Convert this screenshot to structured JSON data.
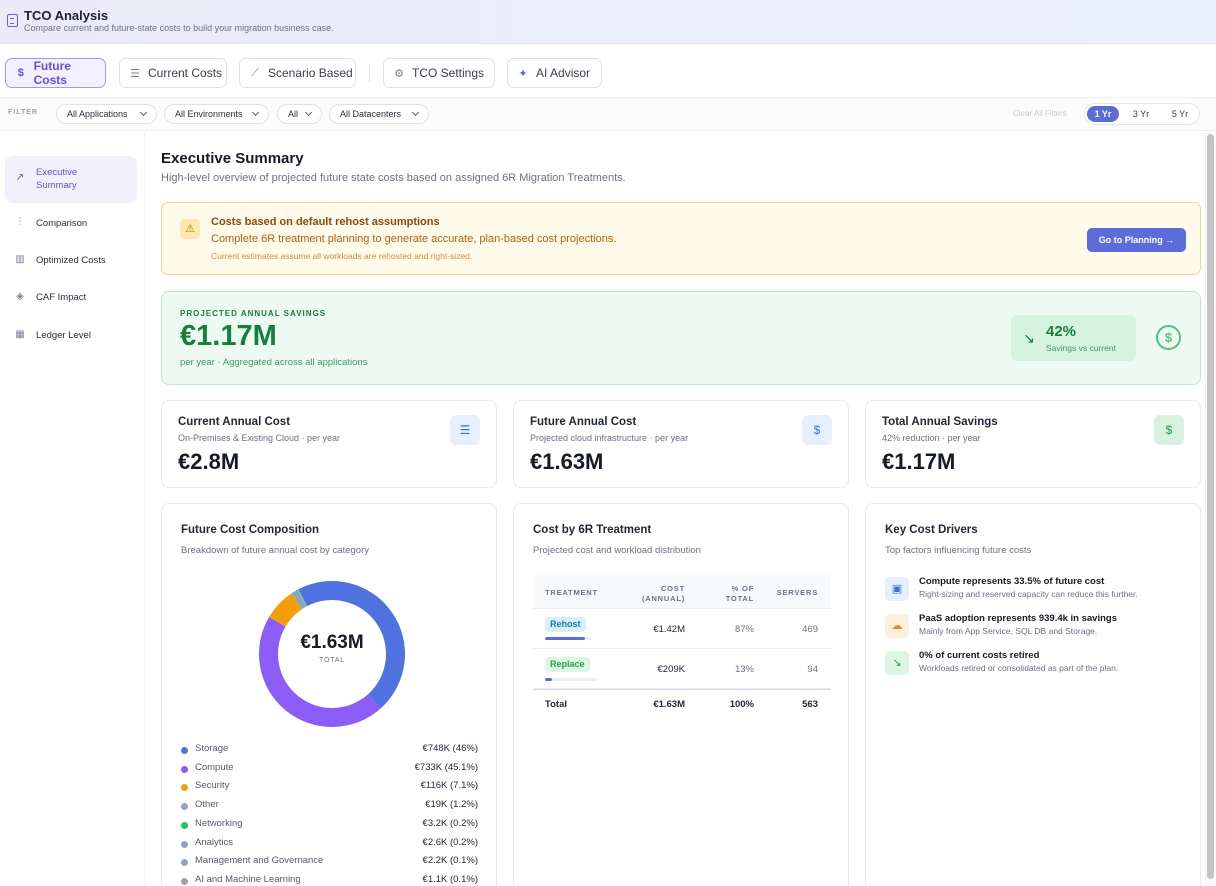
{
  "header": {
    "title": "TCO Analysis",
    "subtitle": "Compare current and future-state costs to build your migration business case."
  },
  "tabs": [
    {
      "label": "Future Costs",
      "icon": "dollar-icon"
    },
    {
      "label": "Current Costs",
      "icon": "server-icon"
    },
    {
      "label": "Scenario Based",
      "icon": "trend-icon"
    },
    {
      "label": "TCO Settings",
      "icon": "gear-icon"
    },
    {
      "label": "AI Advisor",
      "icon": "sparkle-icon"
    }
  ],
  "filters": {
    "label": "FILTER",
    "dropdowns": [
      "All Applications",
      "All Environments",
      "All",
      "All Datacenters"
    ],
    "clear": "Clear All Filters",
    "years": [
      "1 Yr",
      "3 Yr",
      "5 Yr"
    ],
    "selected_year": "1 Yr"
  },
  "sidebar": {
    "items": [
      {
        "label": "Executive Summary",
        "icon": "trend-up-icon"
      },
      {
        "label": "Comparison",
        "icon": "bar-chart-icon"
      },
      {
        "label": "Optimized Costs",
        "icon": "chart-icon"
      },
      {
        "label": "CAF Impact",
        "icon": "layers-icon"
      },
      {
        "label": "Ledger Level",
        "icon": "grid-icon"
      }
    ]
  },
  "summary": {
    "title": "Executive Summary",
    "subtitle": "High-level overview of projected future state costs based on assigned 6R Migration Treatments."
  },
  "warning": {
    "title": "Costs based on default rehost assumptions",
    "message": "Complete 6R treatment planning to generate accurate, plan-based cost projections.",
    "note": "Current estimates assume all workloads are rehosted and right-sized.",
    "button": "Go to Planning →"
  },
  "savings": {
    "label": "PROJECTED ANNUAL SAVINGS",
    "value": "€1.17M",
    "sub": "per year · Aggregated across all applications",
    "pct": "42%",
    "pct_label": "Savings vs current"
  },
  "kpis": [
    {
      "title": "Current Annual Cost",
      "sub": "On-Premises & Existing Cloud · per year",
      "value": "€2.8M",
      "icon": "server-icon"
    },
    {
      "title": "Future Annual Cost",
      "sub": "Projected cloud infrastructure · per year",
      "value": "€1.63M",
      "icon": "dollar-icon"
    },
    {
      "title": "Total Annual Savings",
      "sub": "42% reduction · per year",
      "value": "€1.17M",
      "icon": "dollar-icon"
    }
  ],
  "composition": {
    "title": "Future Cost Composition",
    "subtitle": "Breakdown of future annual cost by category",
    "center_value": "€1.63M",
    "center_label": "TOTAL",
    "legend": [
      {
        "name": "Storage",
        "value": "€748K (46%)",
        "color": "#4e72e0"
      },
      {
        "name": "Compute",
        "value": "€733K (45.1%)",
        "color": "#8b5cf6"
      },
      {
        "name": "Security",
        "value": "€116K (7.1%)",
        "color": "#f59e0b"
      },
      {
        "name": "Other",
        "value": "€19K (1.2%)",
        "color": "#94a3b8"
      },
      {
        "name": "Networking",
        "value": "€3.2K (0.2%)",
        "color": "#22c55e"
      },
      {
        "name": "Analytics",
        "value": "€2.6K (0.2%)",
        "color": "#94a3b8"
      },
      {
        "name": "Management and Governance",
        "value": "€2.2K (0.1%)",
        "color": "#94a3b8"
      },
      {
        "name": "AI and Machine Learning",
        "value": "€1.1K (0.1%)",
        "color": "#94a3b8"
      }
    ]
  },
  "chart_data": {
    "type": "pie",
    "categories": [
      "Storage",
      "Compute",
      "Security",
      "Other",
      "Networking",
      "Analytics",
      "Management and Governance",
      "AI and Machine Learning"
    ],
    "values": [
      46,
      45.1,
      7.1,
      1.2,
      0.2,
      0.2,
      0.1,
      0.1
    ],
    "title": "Future Cost Composition"
  },
  "treatment": {
    "title": "Cost by 6R Treatment",
    "subtitle": "Projected cost and workload distribution",
    "headers": {
      "treatment": "TREATMENT",
      "cost1": "COST",
      "cost2": "(ANNUAL)",
      "pct1": "% OF",
      "pct2": "TOTAL",
      "servers": "SERVERS"
    },
    "rows": [
      {
        "name": "Rehost",
        "cost": "€1.42M",
        "pct": "87%",
        "servers": "469",
        "share": 0.87
      },
      {
        "name": "Replace",
        "cost": "€209K",
        "pct": "13%",
        "servers": "94",
        "share": 0.13
      }
    ],
    "total": {
      "name": "Total",
      "cost": "€1.63M",
      "pct": "100%",
      "servers": "563"
    }
  },
  "drivers": {
    "title": "Key Cost Drivers",
    "subtitle": "Top factors influencing future costs",
    "items": [
      {
        "title": "Compute represents 33.5% of future cost",
        "desc": "Right-sizing and reserved capacity can reduce this further.",
        "icon": "chip-icon"
      },
      {
        "title": "PaaS adoption represents 939.4k in savings",
        "desc": "Mainly from App Service, SQL DB and Storage.",
        "icon": "cloud-icon"
      },
      {
        "title": "0% of current costs retired",
        "desc": "Workloads retired or consolidated as part of the plan.",
        "icon": "trend-down-icon"
      }
    ]
  }
}
